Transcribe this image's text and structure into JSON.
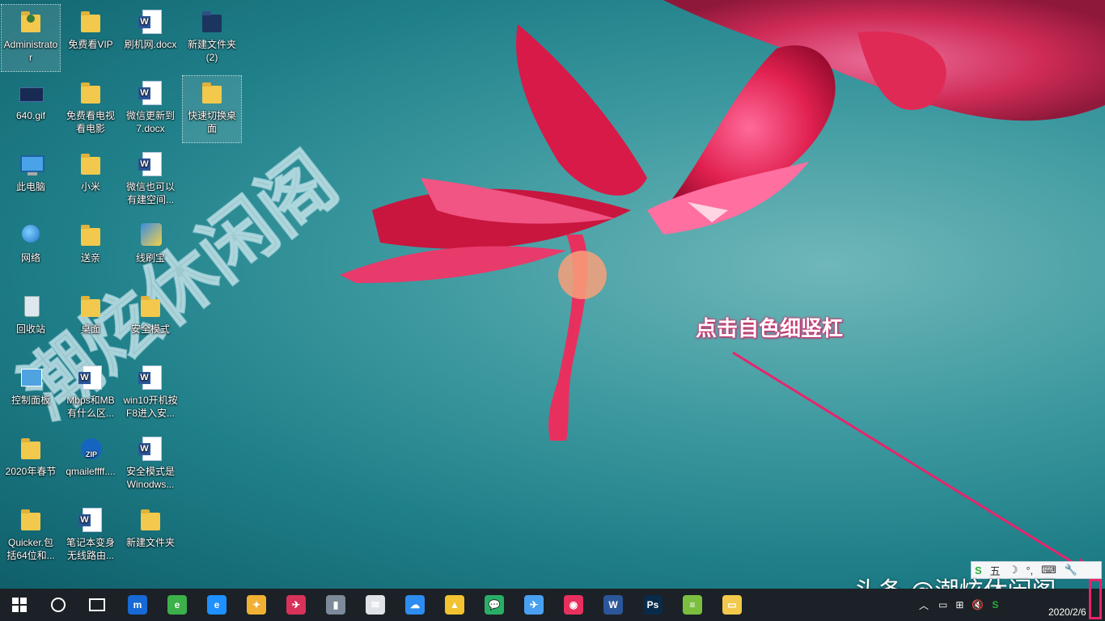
{
  "desktop": {
    "icons": [
      {
        "label": "Administrator",
        "kind": "user",
        "selected": true
      },
      {
        "label": "免费看VIP",
        "kind": "folder"
      },
      {
        "label": "刷机网.docx",
        "kind": "word"
      },
      {
        "label": "新建文件夹 (2)",
        "kind": "folder-dark"
      },
      {
        "label": "640.gif",
        "kind": "gif"
      },
      {
        "label": "免费看电视看电影",
        "kind": "folder"
      },
      {
        "label": "微信更新到7.docx",
        "kind": "word"
      },
      {
        "label": "快速切换桌面",
        "kind": "folder",
        "selected": true
      },
      {
        "label": "此电脑",
        "kind": "pc"
      },
      {
        "label": "小米",
        "kind": "folder"
      },
      {
        "label": "微信也可以有建空间...",
        "kind": "word"
      },
      {
        "label": "网络",
        "kind": "network"
      },
      {
        "label": "送亲",
        "kind": "folder"
      },
      {
        "label": "线刷宝",
        "kind": "shield"
      },
      {
        "label": "回收站",
        "kind": "bin"
      },
      {
        "label": "桌面",
        "kind": "folder"
      },
      {
        "label": "安全模式",
        "kind": "folder"
      },
      {
        "label": "控制面板",
        "kind": "control"
      },
      {
        "label": "Mbps和MB有什么区...",
        "kind": "word"
      },
      {
        "label": "win10开机按F8进入安...",
        "kind": "word"
      },
      {
        "label": "2020年春节",
        "kind": "folder"
      },
      {
        "label": "qmaileffff....",
        "kind": "zip"
      },
      {
        "label": "安全模式是Winodws...",
        "kind": "word"
      },
      {
        "label": "Quicker.包括64位和...",
        "kind": "folder"
      },
      {
        "label": "笔记本变身无线路由...",
        "kind": "word"
      },
      {
        "label": "新建文件夹",
        "kind": "folder"
      }
    ],
    "watermark": "潮炫休闲阁",
    "annotation": "点击自色细竖杠",
    "brand_overlay": "头条 @潮炫休闲阁"
  },
  "ime_bar": {
    "items": [
      "S",
      "五",
      "☽",
      "°,",
      "⌨",
      "🔧"
    ]
  },
  "taskbar": {
    "apps": [
      {
        "name": "maxthon",
        "color": "#1769d6",
        "label": "m"
      },
      {
        "name": "ie360",
        "color": "#3cb04a",
        "label": "e"
      },
      {
        "name": "edge",
        "color": "#1e90ff",
        "label": "e"
      },
      {
        "name": "app-yellow",
        "color": "#f2b134",
        "label": "✦"
      },
      {
        "name": "app-red",
        "color": "#d8325b",
        "label": "✈"
      },
      {
        "name": "app-grey",
        "color": "#7c8a99",
        "label": "▮"
      },
      {
        "name": "mail",
        "color": "#dfe3e8",
        "label": "✉"
      },
      {
        "name": "baidu-netdisk",
        "color": "#2d8cf0",
        "label": "☁"
      },
      {
        "name": "app-stripes",
        "color": "#f2c230",
        "label": "▲"
      },
      {
        "name": "wechat",
        "color": "#2aae67",
        "label": "💬"
      },
      {
        "name": "feiyu",
        "color": "#4aa0f0",
        "label": "✈"
      },
      {
        "name": "app-pink",
        "color": "#e8305f",
        "label": "◉"
      },
      {
        "name": "word",
        "color": "#2b579a",
        "label": "W"
      },
      {
        "name": "photoshop",
        "color": "#0a2a4a",
        "label": "Ps"
      },
      {
        "name": "app-green",
        "color": "#7cbf3f",
        "label": "≡"
      },
      {
        "name": "explorer",
        "color": "#f2c94c",
        "label": "▭"
      }
    ],
    "clock": "2020/2/6"
  }
}
